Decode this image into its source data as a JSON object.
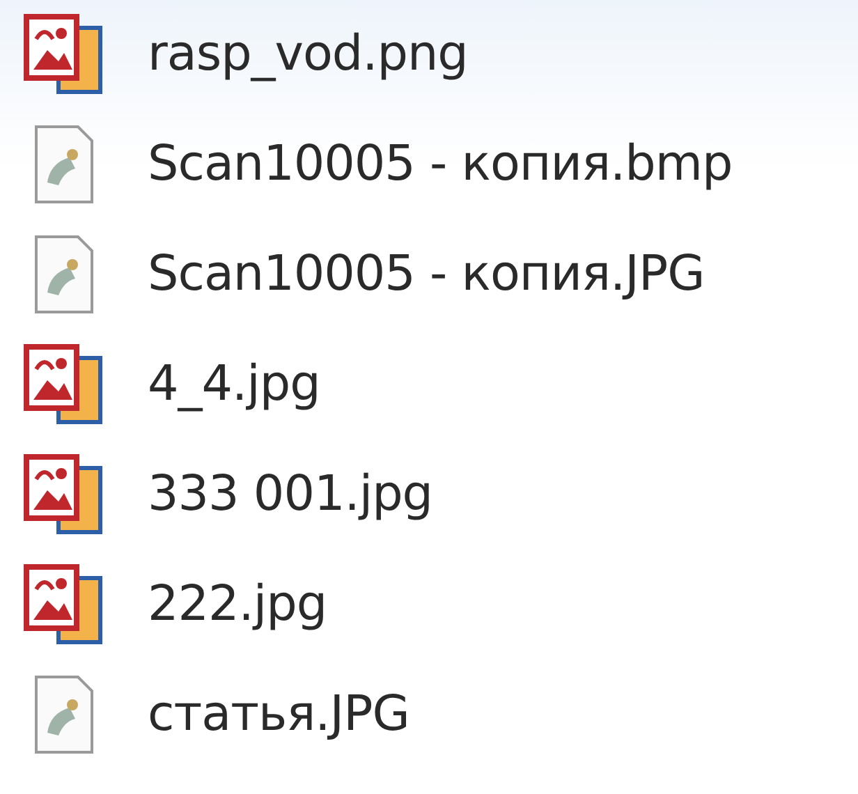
{
  "files": [
    {
      "name": "rasp_vod.png",
      "kind": "image"
    },
    {
      "name": "Scan10005 - копия.bmp",
      "kind": "file"
    },
    {
      "name": "Scan10005 - копия.JPG",
      "kind": "file"
    },
    {
      "name": "4_4.jpg",
      "kind": "image"
    },
    {
      "name": "333 001.jpg",
      "kind": "image"
    },
    {
      "name": "222.jpg",
      "kind": "image"
    },
    {
      "name": "статья.JPG",
      "kind": "file"
    }
  ]
}
